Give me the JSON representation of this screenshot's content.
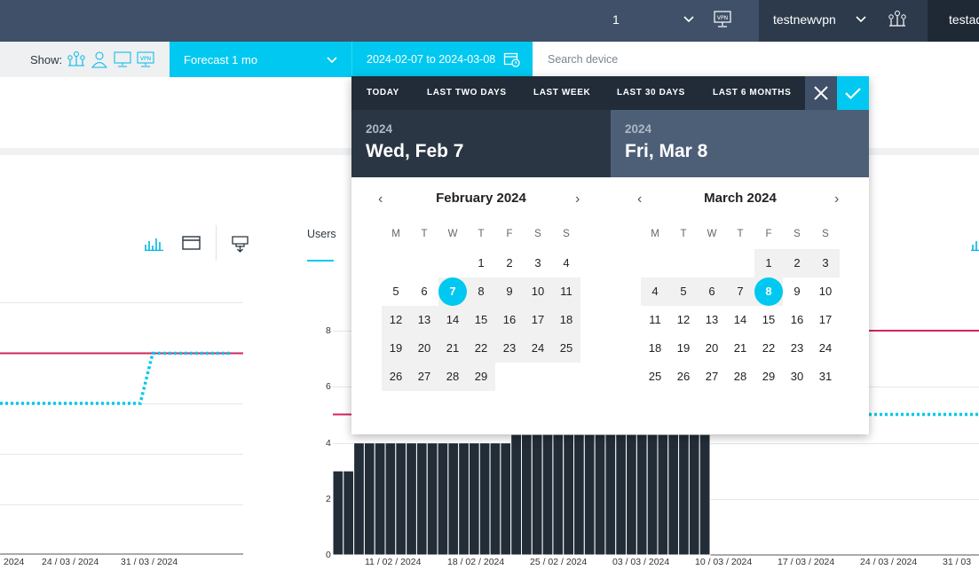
{
  "topbar": {
    "selected_count": "1",
    "user": "testnewvpn",
    "other_user": "testad"
  },
  "toolbar": {
    "show_label": "Show:",
    "forecast": "Forecast 1 mo",
    "date_range": "2024-02-07 to 2024-03-08",
    "search_placeholder": "Search device"
  },
  "charts": {
    "tab_users": "Users",
    "left_x": [
      "2024",
      "24 / 03 / 2024",
      "31 / 03 / 2024"
    ],
    "y_ticks": [
      "8",
      "6",
      "4",
      "2",
      "0"
    ],
    "right_x": [
      "11 / 02 / 2024",
      "18 / 02 / 2024",
      "25 / 02 / 2024",
      "03 / 03 / 2024",
      "10 / 03 / 2024",
      "17 / 03 / 2024",
      "24 / 03 / 2024",
      "31 / 03"
    ],
    "bar_values": [
      3,
      3,
      4,
      4,
      4,
      4,
      4,
      4,
      4,
      4,
      4,
      4,
      4,
      4,
      4,
      4,
      4,
      4.3,
      4.3,
      4.3,
      4.3,
      4.3,
      4.3,
      4.3,
      4.3,
      4.3,
      4.3,
      4.3,
      4.3,
      4.3,
      4.3,
      4.3,
      4.3,
      4.3,
      4.3,
      4.3
    ],
    "colors": {
      "bar": "#232d38",
      "limit": "#d0245e",
      "forecast": "#00c8f0"
    }
  },
  "datepicker": {
    "presets": [
      "TODAY",
      "LAST TWO DAYS",
      "LAST WEEK",
      "LAST 30 DAYS",
      "LAST 6 MONTHS"
    ],
    "start": {
      "year": "2024",
      "date": "Wed, Feb 7"
    },
    "end": {
      "year": "2024",
      "date": "Fri, Mar 8"
    },
    "weekdays": [
      "M",
      "T",
      "W",
      "T",
      "F",
      "S",
      "S"
    ],
    "months": [
      {
        "title": "February 2024",
        "offset": 3,
        "days": 29,
        "selected": 7,
        "range_from": 7,
        "range_to": 29
      },
      {
        "title": "March 2024",
        "offset": 4,
        "days": 31,
        "selected": 8,
        "range_from": 1,
        "range_to": 8
      }
    ]
  }
}
